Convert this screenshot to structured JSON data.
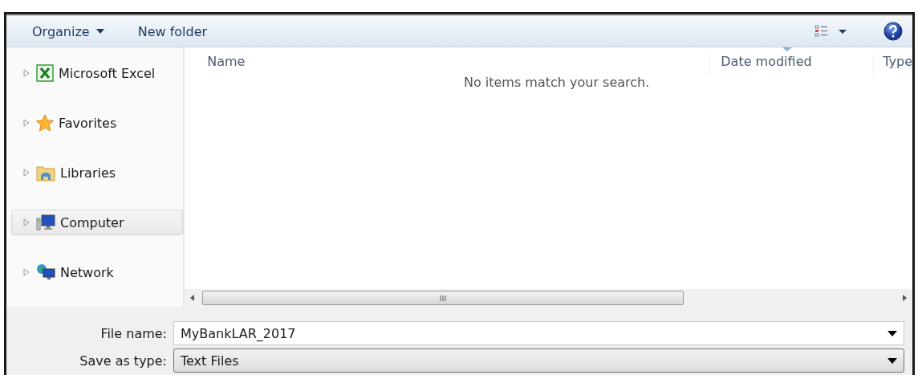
{
  "toolbar": {
    "organize": "Organize",
    "new_folder": "New folder"
  },
  "sidebar": {
    "items": [
      {
        "label": "Microsoft Excel",
        "kind": "excel",
        "selected": false
      },
      {
        "label": "Favorites",
        "kind": "star",
        "selected": false
      },
      {
        "label": "Libraries",
        "kind": "library",
        "selected": false
      },
      {
        "label": "Computer",
        "kind": "computer",
        "selected": true
      },
      {
        "label": "Network",
        "kind": "network",
        "selected": false
      }
    ]
  },
  "columns": [
    "Name",
    "Date modified",
    "Type"
  ],
  "empty_message": "No items match your search.",
  "file_name": {
    "label": "File name:",
    "value": "MyBankLAR_2017"
  },
  "save_as_type": {
    "label": "Save as type:",
    "value": "Text Files"
  }
}
